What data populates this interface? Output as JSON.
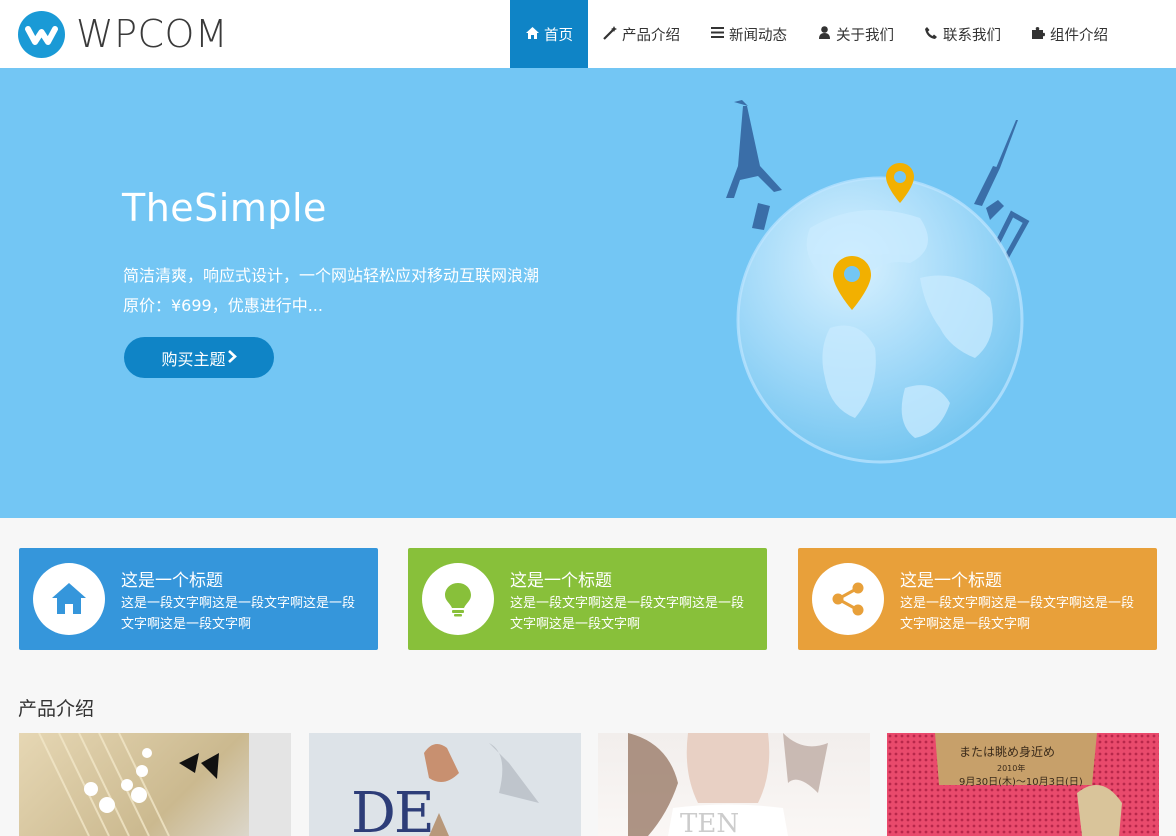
{
  "site": {
    "logo_text": "WPCOM"
  },
  "nav": {
    "items": [
      {
        "label": "首页",
        "icon": "home-icon",
        "active": true
      },
      {
        "label": "产品介绍",
        "icon": "magic-wand-icon",
        "active": false
      },
      {
        "label": "新闻动态",
        "icon": "list-icon",
        "active": false
      },
      {
        "label": "关于我们",
        "icon": "user-icon",
        "active": false
      },
      {
        "label": "联系我们",
        "icon": "phone-icon",
        "active": false
      },
      {
        "label": "组件介绍",
        "icon": "puzzle-icon",
        "active": false
      }
    ]
  },
  "hero": {
    "title": "TheSimple",
    "line1": "简洁清爽，响应式设计，一个网站轻松应对移动互联网浪潮",
    "line2": "原价：¥699，优惠进行中...",
    "button": "购买主题",
    "bg_color": "#73c6f4"
  },
  "features": [
    {
      "title": "这是一个标题",
      "desc": "这是一段文字啊这是一段文字啊这是一段文字啊这是一段文字啊",
      "icon": "home-icon",
      "color": "#3596db"
    },
    {
      "title": "这是一个标题",
      "desc": "这是一段文字啊这是一段文字啊这是一段文字啊这是一段文字啊",
      "icon": "lightbulb-icon",
      "color": "#88c03a"
    },
    {
      "title": "这是一个标题",
      "desc": "这是一段文字啊这是一段文字啊这是一段文字啊这是一段文字啊",
      "icon": "share-icon",
      "color": "#e8a03a"
    }
  ],
  "products": {
    "title": "产品介绍",
    "items": [
      {
        "name": "product-card-1"
      },
      {
        "name": "product-card-2",
        "caption": "DE"
      },
      {
        "name": "product-card-3",
        "caption": "TEN"
      },
      {
        "name": "product-card-4",
        "caption": "または眺め身近め",
        "date": "9月30日(木)〜10月3日(日)",
        "year": "2010年"
      }
    ]
  },
  "colors": {
    "accent": "#0f84c6"
  }
}
